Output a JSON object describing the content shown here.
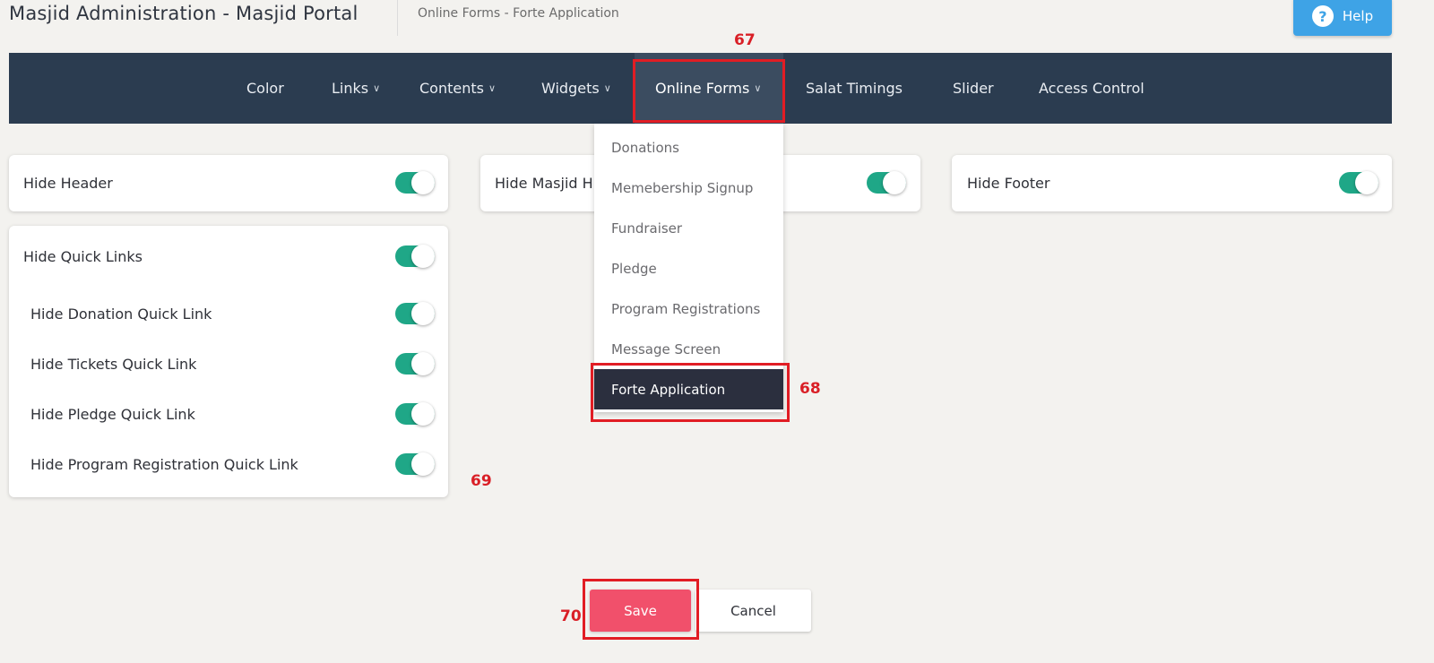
{
  "header": {
    "app_title": "Masjid Administration - Masjid Portal",
    "breadcrumb": "Online Forms - Forte Application",
    "help_label": "Help",
    "help_icon": "?"
  },
  "nav": {
    "items": [
      {
        "label": "Color",
        "has_dropdown": false
      },
      {
        "label": "Links",
        "has_dropdown": true
      },
      {
        "label": "Contents",
        "has_dropdown": true
      },
      {
        "label": "Widgets",
        "has_dropdown": true
      },
      {
        "label": "Online Forms",
        "has_dropdown": true,
        "active": true
      },
      {
        "label": "Salat Timings",
        "has_dropdown": false
      },
      {
        "label": "Slider",
        "has_dropdown": false
      },
      {
        "label": "Access Control",
        "has_dropdown": false
      }
    ],
    "chevron": "∨"
  },
  "dropdown": {
    "items": [
      "Donations",
      "Memebership Signup",
      "Fundraiser",
      "Pledge",
      "Program Registrations",
      "Message Screen",
      "Forte Application"
    ],
    "selected": "Forte Application"
  },
  "settings": {
    "hide_header": {
      "label": "Hide Header",
      "on": true
    },
    "hide_masjid": {
      "label": "Hide Masjid H",
      "on": true
    },
    "hide_footer": {
      "label": "Hide Footer",
      "on": true
    },
    "quick_links": {
      "label": "Hide Quick Links",
      "on": true,
      "items": [
        {
          "label": "Hide Donation Quick Link",
          "on": true
        },
        {
          "label": "Hide Tickets Quick Link",
          "on": true
        },
        {
          "label": "Hide Pledge Quick Link",
          "on": true
        },
        {
          "label": "Hide Program Registration Quick Link",
          "on": true
        }
      ]
    }
  },
  "actions": {
    "save_label": "Save",
    "cancel_label": "Cancel"
  },
  "annotations": {
    "a67": "67",
    "a68": "68",
    "a69": "69",
    "a70": "70"
  },
  "colors": {
    "navbar": "#2b3c50",
    "toggle_on": "#1fa787",
    "save": "#f1506b",
    "help": "#3ea3e6",
    "annotation": "#e11d24"
  }
}
